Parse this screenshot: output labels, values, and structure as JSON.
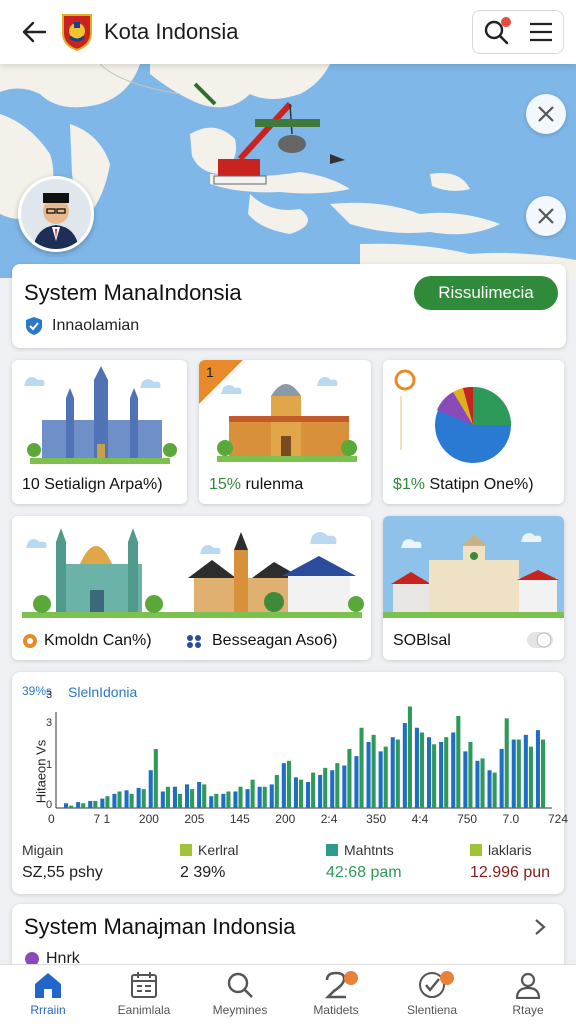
{
  "header": {
    "title": "Kota Indonsia",
    "back_icon": "arrow-left-icon",
    "logo_icon": "crest-logo-icon",
    "search_icon": "search-icon",
    "menu_icon": "hamburger-menu-icon"
  },
  "colors": {
    "accent": "#2f8a3a",
    "map_water": "#7fb7e8",
    "bar_blue": "#1e6fc4",
    "bar_green": "#2e9a5a",
    "nav_active": "#2266cc"
  },
  "system_card": {
    "title": "System ManaIndonsia",
    "subtitle": "Innaolamian",
    "button": "Rissulimecia"
  },
  "tiles": [
    {
      "prefix": "10 ",
      "pct": "",
      "label": "Setialign Arpa%)"
    },
    {
      "prefix": "",
      "pct": "15%",
      "label": " rulenma",
      "badge": "1"
    },
    {
      "prefix": "",
      "pct": "$1%",
      "label": " Statipn One%)"
    },
    {
      "label": "Kmoldn Can%)"
    },
    {
      "label": "Besseagan Aso6)"
    },
    {
      "label": "SOBlsal"
    }
  ],
  "chart": {
    "corner_label": "39%s",
    "title": "SlelnIdonia",
    "y_axis_label": "Hitaeon Vs",
    "y_ticks": [
      "0",
      "1",
      "3",
      "3"
    ],
    "x_ticks": [
      "0",
      "7 1",
      "200",
      "205",
      "145",
      "200",
      "2:4",
      "350",
      "4:4",
      "750",
      "7.0",
      "724"
    ]
  },
  "chart_data": {
    "type": "bar",
    "title": "SlelnIdonia",
    "ylabel": "Hitaeon Vs",
    "ylim": [
      0,
      5
    ],
    "series": [
      {
        "values": [
          0.2,
          0.25,
          0.3,
          0.4,
          0.6,
          0.75,
          0.85,
          1.6,
          0.7,
          0.9,
          1.0,
          1.1,
          0.5,
          0.6,
          0.7,
          0.8,
          0.9,
          1.0,
          1.9,
          1.3,
          1.1,
          1.4,
          1.6,
          1.8,
          2.2,
          2.8,
          2.4,
          3.0,
          3.6,
          3.4,
          3.0,
          2.8,
          3.2,
          2.4,
          2.0,
          1.6,
          2.5,
          2.9,
          3.1,
          3.3
        ]
      },
      {
        "values": [
          0.1,
          0.2,
          0.3,
          0.5,
          0.7,
          0.6,
          0.8,
          2.5,
          0.9,
          0.6,
          0.8,
          1.0,
          0.6,
          0.7,
          0.9,
          1.2,
          0.9,
          1.4,
          2.0,
          1.2,
          1.5,
          1.7,
          1.9,
          2.5,
          3.4,
          3.1,
          2.6,
          2.9,
          4.3,
          3.2,
          2.7,
          3.0,
          3.9,
          2.8,
          2.1,
          1.5,
          3.8,
          2.9,
          2.6,
          2.9
        ]
      }
    ]
  },
  "stats": [
    {
      "label": "Migain",
      "value": "SZ,55 pshy",
      "color": ""
    },
    {
      "label": "Kerlral",
      "value": "2 39%",
      "color": "#9fc43a"
    },
    {
      "label": "Mahtnts",
      "value": "42:68 pam",
      "color": "#2e9a8a"
    },
    {
      "label": "laklaris",
      "value": "12.996 pun",
      "color": "#9fc43a"
    }
  ],
  "section2": {
    "title": "System Manajman Indonsia",
    "subtitle": "Hnrk"
  },
  "nav": [
    {
      "label": "Rrraiin",
      "icon": "home-icon",
      "active": true
    },
    {
      "label": "Eanimlala",
      "icon": "calendar-icon"
    },
    {
      "label": "Meymines",
      "icon": "search-icon"
    },
    {
      "label": "Matidets",
      "icon": "notification-icon",
      "badge": true
    },
    {
      "label": "Slentiena",
      "icon": "checklist-icon",
      "badge": true
    },
    {
      "label": "Rtaye",
      "icon": "profile-icon"
    }
  ]
}
